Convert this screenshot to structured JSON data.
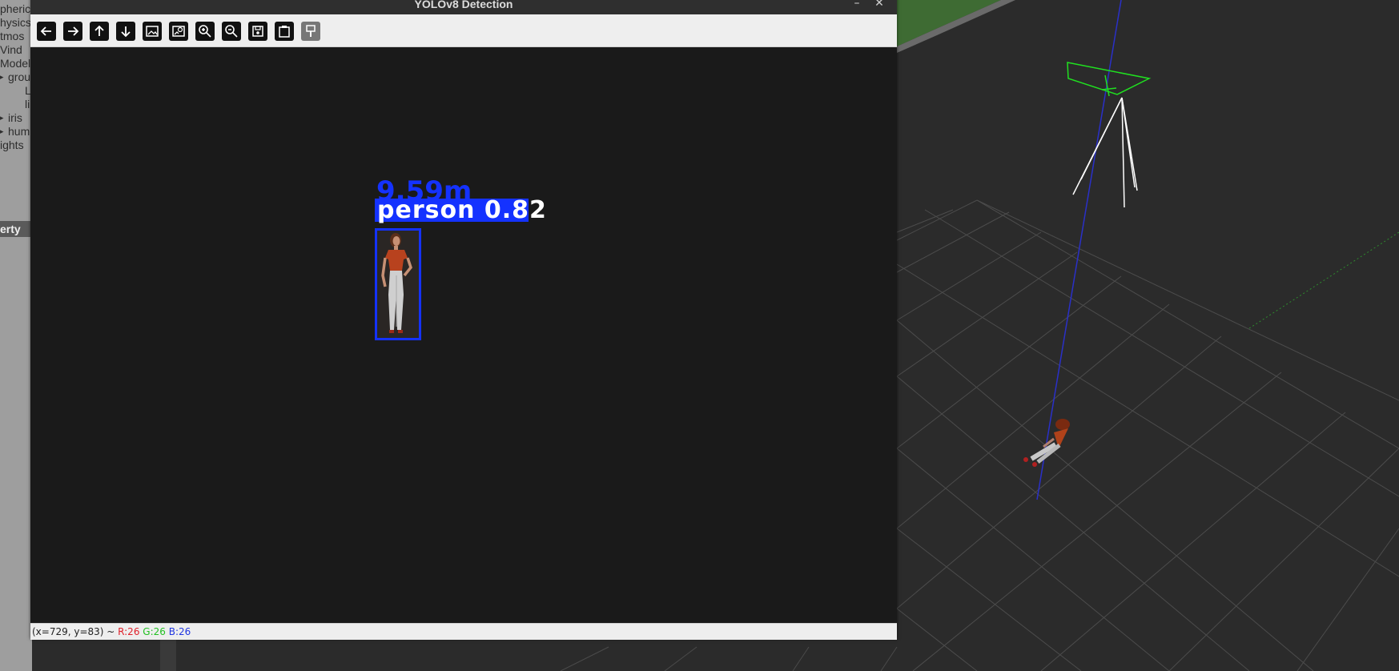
{
  "window": {
    "title": "YOLOv8 Detection",
    "minimize_icon": "minimize-icon",
    "close_icon": "close-icon"
  },
  "toolbar": {
    "buttons": [
      {
        "name": "pan-left",
        "icon": "arrow-left-icon"
      },
      {
        "name": "pan-right",
        "icon": "arrow-right-icon"
      },
      {
        "name": "pan-up",
        "icon": "arrow-up-icon"
      },
      {
        "name": "pan-down",
        "icon": "arrow-down-icon"
      },
      {
        "name": "zoom-to-fit",
        "icon": "image-icon"
      },
      {
        "name": "zoom-original",
        "icon": "image-zoom-icon"
      },
      {
        "name": "zoom-in",
        "icon": "zoom-in-icon"
      },
      {
        "name": "zoom-out",
        "icon": "zoom-out-icon"
      },
      {
        "name": "save-image",
        "icon": "save-icon"
      },
      {
        "name": "copy-clipboard",
        "icon": "clipboard-icon"
      },
      {
        "name": "properties",
        "icon": "brush-icon"
      }
    ]
  },
  "detection": {
    "label": "person  0.82",
    "distance": "9.59m",
    "box_color": "#1432ff"
  },
  "status": {
    "coords": "(x=729, y=83) ~ ",
    "r": "R:26",
    "g": "G:26",
    "b": "B:26"
  },
  "gazebo_panel": {
    "tree_items": [
      "pheric",
      "hysics",
      "tmos",
      "Vind",
      "Models",
      "grou",
      "L",
      "li",
      "iris",
      "hum",
      "ights"
    ],
    "property_header": "erty"
  }
}
